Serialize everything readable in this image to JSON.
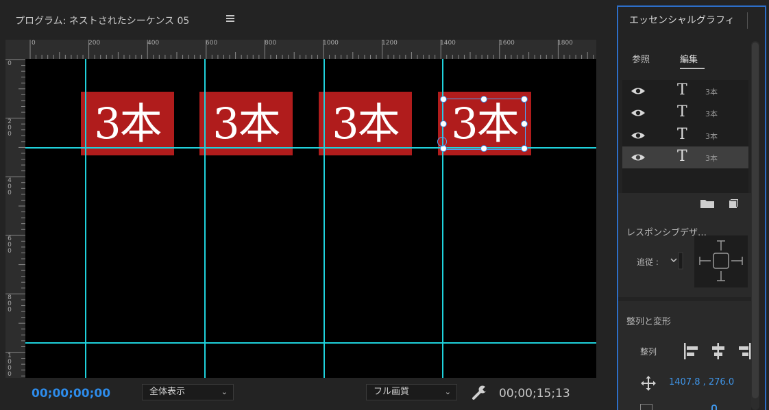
{
  "program_monitor": {
    "title": "プログラム: ネストされたシーケンス 05",
    "ruler_h_labels": [
      "0",
      "200",
      "400",
      "600",
      "800",
      "1000",
      "1200",
      "1400",
      "1600",
      "1800"
    ],
    "ruler_v_labels": [
      "0",
      "200",
      "400",
      "600",
      "800",
      "1000"
    ],
    "clips": [
      {
        "text": "3本"
      },
      {
        "text": "3本"
      },
      {
        "text": "3本"
      },
      {
        "text": "3本"
      }
    ],
    "timecode_current": "00;00;00;00",
    "zoom_select": "全体表示",
    "quality_select": "フル画質",
    "timecode_duration": "00;00;15;13"
  },
  "essential_graphics": {
    "title": "エッセンシャルグラフィ",
    "tabs": [
      {
        "label": "参照",
        "active": false
      },
      {
        "label": "編集",
        "active": true
      }
    ],
    "layers": [
      {
        "name": "3本",
        "selected": false
      },
      {
        "name": "3本",
        "selected": false
      },
      {
        "name": "3本",
        "selected": false
      },
      {
        "name": "3本",
        "selected": true
      }
    ],
    "responsive_title": "レスポンシブデザ…",
    "follow_label": "追従 :",
    "align_section_title": "整列と変形",
    "align_label": "整列",
    "position_value": "1407.8 ,  276.0"
  },
  "colors": {
    "accent_blue": "#2d8ceb",
    "guide_cyan": "#1fd2dc",
    "clip_red": "#b01c1c",
    "panel_border_blue": "#2d6ec7"
  }
}
